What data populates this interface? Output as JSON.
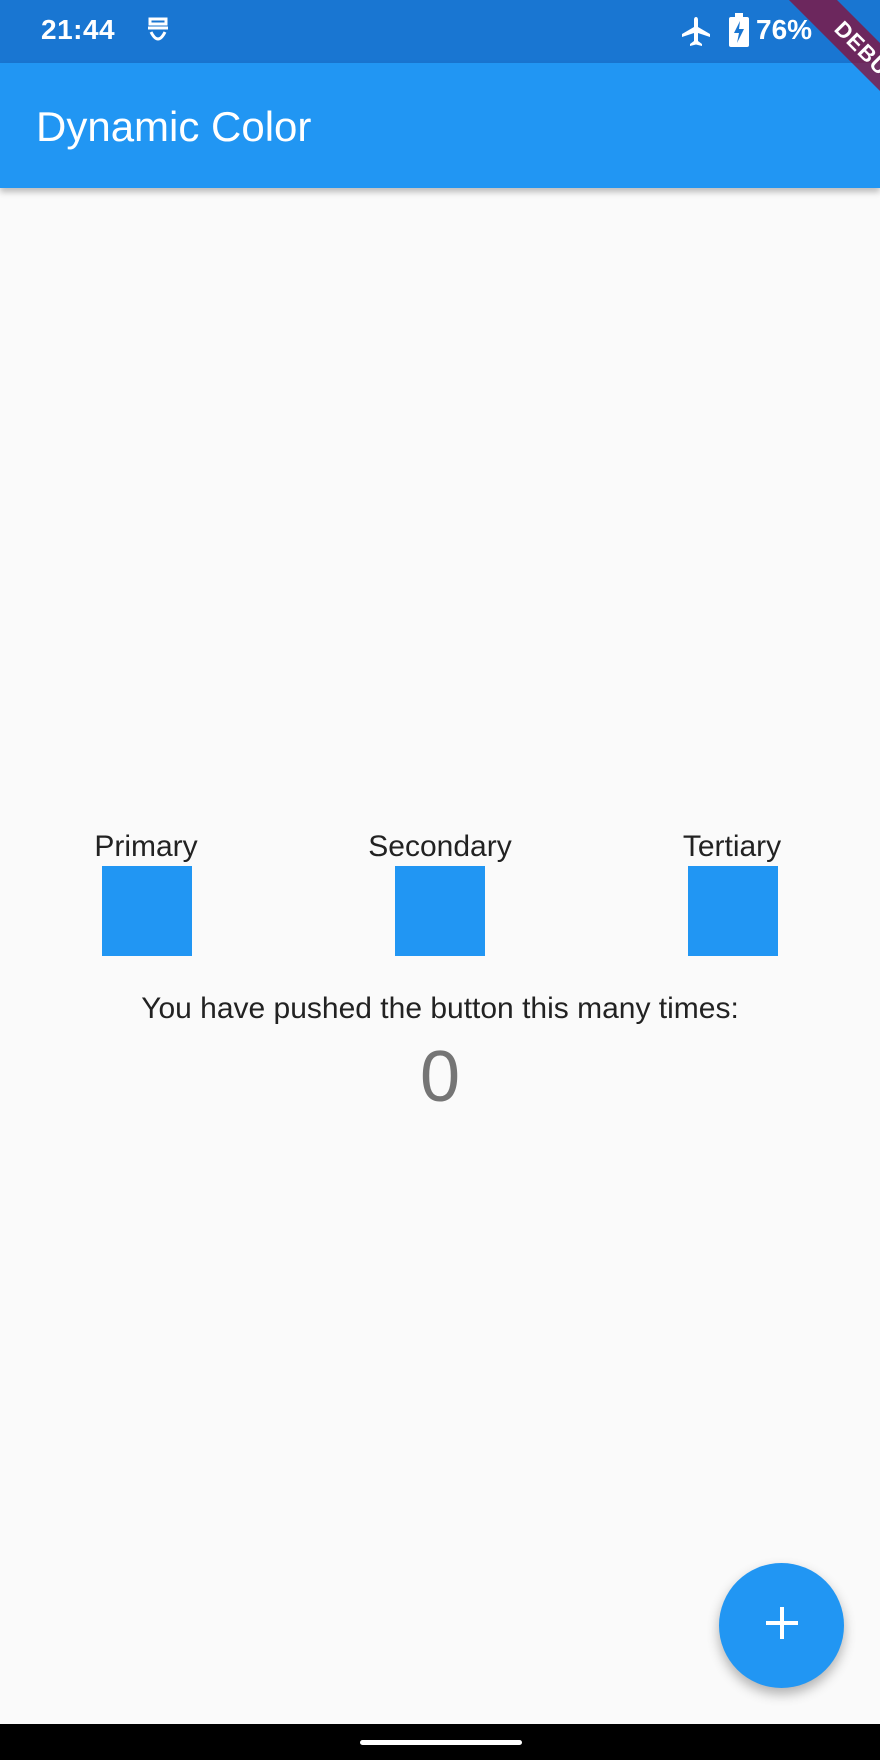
{
  "status_bar": {
    "time": "21:44",
    "battery": "76%",
    "icons": [
      "app-notification-icon",
      "airplane-mode-icon",
      "battery-charging-icon"
    ],
    "background_color": "#1976d2"
  },
  "app_bar": {
    "title": "Dynamic Color",
    "background_color": "#2196f3"
  },
  "debug_banner": "DEBUG",
  "swatches": [
    {
      "label": "Primary",
      "color": "#2196f3"
    },
    {
      "label": "Secondary",
      "color": "#2196f3"
    },
    {
      "label": "Tertiary",
      "color": "#2196f3"
    }
  ],
  "counter": {
    "caption": "You have pushed the button this many times:",
    "value": "0"
  },
  "fab": {
    "icon": "plus-icon",
    "color": "#2196f3"
  }
}
